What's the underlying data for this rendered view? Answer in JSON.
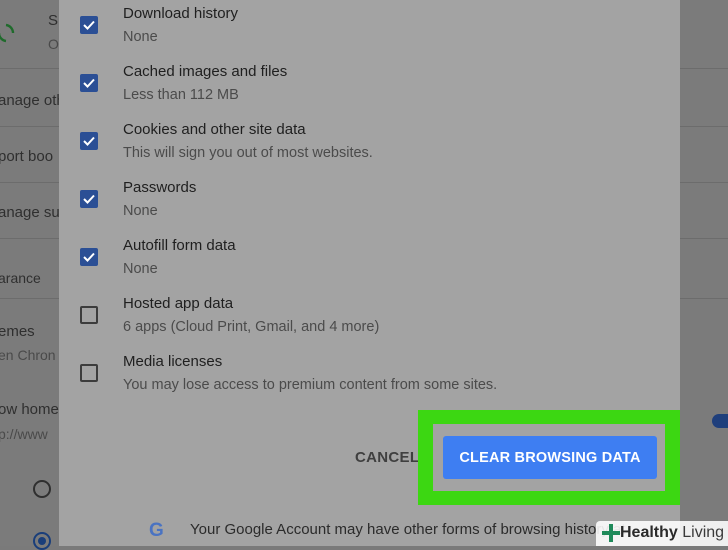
{
  "background": {
    "top_line_1": "S",
    "top_line_2": "O",
    "items": [
      "anage oth",
      "port boo",
      "anage su"
    ],
    "section_title": "arance",
    "themes_label": "emes",
    "themes_sub": "en Chron",
    "home_label": "ow home",
    "home_sub": "p://www"
  },
  "dialog": {
    "options": [
      {
        "label": "Download history",
        "sub": "None",
        "checked": true
      },
      {
        "label": "Cached images and files",
        "sub": "Less than 112 MB",
        "checked": true
      },
      {
        "label": "Cookies and other site data",
        "sub": "This will sign you out of most websites.",
        "checked": true
      },
      {
        "label": "Passwords",
        "sub": "None",
        "checked": true
      },
      {
        "label": "Autofill form data",
        "sub": "None",
        "checked": true
      },
      {
        "label": "Hosted app data",
        "sub": "6 apps (Cloud Print, Gmail, and 4 more)",
        "checked": false
      },
      {
        "label": "Media licenses",
        "sub": "You may lose access to premium content from some sites.",
        "checked": false
      }
    ],
    "cancel_label": "CANCEL",
    "clear_label": "CLEAR BROWSING DATA",
    "footer_icon": "google-g-icon",
    "footer_text": "Your Google Account may have other forms of browsing history at"
  },
  "watermark": {
    "bold": "Healthy",
    "light": "Living"
  },
  "colors": {
    "accent": "#3e7ef2",
    "highlight": "#3cd712",
    "checkbox": "#2b4f95"
  }
}
